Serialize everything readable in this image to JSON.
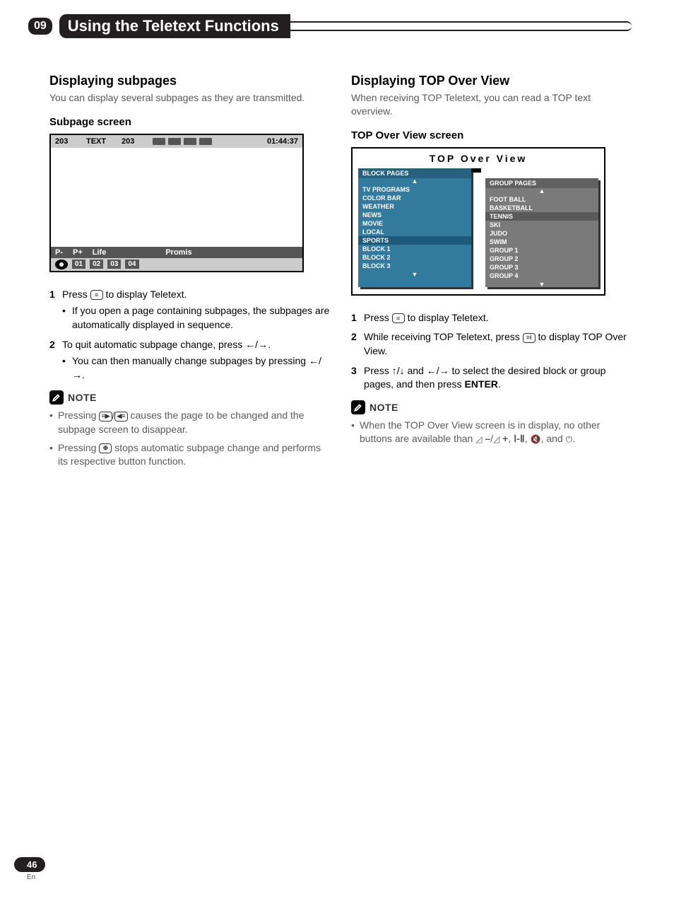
{
  "header": {
    "badge": "09",
    "title": "Using the Teletext Functions"
  },
  "left": {
    "heading": "Displaying subpages",
    "intro": "You can display several subpages as they are transmitted.",
    "subheading": "Subpage screen",
    "screen": {
      "page_a": "203",
      "text_label": "TEXT",
      "page_b": "203",
      "time": "01:44:37",
      "p_minus": "P-",
      "p_plus": "P+",
      "life": "Life",
      "promis": "Promis",
      "cells": [
        "01",
        "02",
        "03",
        "04"
      ]
    },
    "steps": [
      {
        "num": "1",
        "pre": "Press ",
        "post": " to display Teletext.",
        "bullets": [
          "If you open a page containing subpages, the subpages are automatically displayed in sequence."
        ]
      },
      {
        "num": "2",
        "pre": "To quit automatic subpage change, press ",
        "arrows1": "←/→",
        "post": ".",
        "bullets": [
          "You can then manually change subpages by pressing ←/→."
        ]
      }
    ],
    "note_label": "NOTE",
    "notes": [
      "Pressing [≡▶]/[◀≡] causes the page to be changed and the subpage screen to disappear.",
      "Pressing [⊕] stops automatic subpage change and performs its respective button function."
    ]
  },
  "right": {
    "heading": "Displaying TOP Over View",
    "intro": "When receiving TOP Teletext, you can read a TOP text overview.",
    "subheading": "TOP Over View screen",
    "screen": {
      "title": "TOP Over View",
      "block_hdr": "BLOCK PAGES",
      "block_items": [
        "TV PROGRAMS",
        "COLOR BAR",
        "WEATHER",
        "NEWS",
        "MOVIE",
        "LOCAL",
        "SPORTS",
        "BLOCK 1",
        "BLOCK 2",
        "BLOCK 3"
      ],
      "block_highlight_index": 6,
      "group_hdr": "GROUP PAGES",
      "group_items": [
        "FOOT BALL",
        "BASKETBALL",
        "TENNIS",
        "SKI",
        "JUDO",
        "SWIM",
        "GROUP 1",
        "GROUP 2",
        "GROUP 3",
        "GROUP 4"
      ],
      "group_highlight_index": 2
    },
    "steps": [
      {
        "num": "1",
        "pre": "Press ",
        "post": " to display Teletext."
      },
      {
        "num": "2",
        "pre": "While receiving TOP Teletext, press ",
        "post": " to display TOP Over View."
      },
      {
        "num": "3",
        "text": "Press ↑/↓ and ←/→ to select the desired block or group pages, and then press ",
        "enter": "ENTER",
        "post2": "."
      }
    ],
    "note_label": "NOTE",
    "notes": [
      "When the TOP Over View screen is in display, no other buttons are available than ⌂ –/⌂ +, Ⅰ-Ⅱ, 🔇, and ⏻."
    ]
  },
  "footer": {
    "page": "46",
    "lang": "En"
  }
}
